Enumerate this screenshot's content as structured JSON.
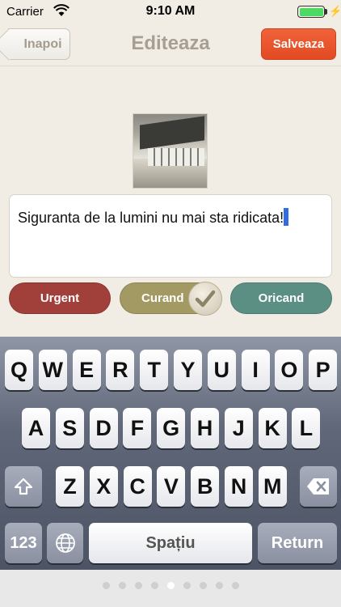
{
  "status_bar": {
    "carrier": "Carrier",
    "time": "9:10 AM",
    "battery_level": 1.0,
    "charging": true
  },
  "nav": {
    "back_label": "Inapoi",
    "title": "Editeaza",
    "save_label": "Salveaza"
  },
  "photo": {
    "icon": "photo-thumbnail"
  },
  "note": {
    "text": "Siguranta de la lumini nu mai sta ridicata",
    "trailing_char": "!"
  },
  "priority": {
    "options": [
      {
        "label": "Urgent",
        "color": "#a1403a",
        "selected": false
      },
      {
        "label": "Curand",
        "color": "#a39a63",
        "selected": true
      },
      {
        "label": "Oricand",
        "color": "#5b8f84",
        "selected": false
      }
    ]
  },
  "keyboard": {
    "row1": [
      "Q",
      "W",
      "E",
      "R",
      "T",
      "Y",
      "U",
      "I",
      "O",
      "P"
    ],
    "row2": [
      "A",
      "S",
      "D",
      "F",
      "G",
      "H",
      "J",
      "K",
      "L"
    ],
    "row3": [
      "Z",
      "X",
      "C",
      "V",
      "B",
      "N",
      "M"
    ],
    "numbers_label": "123",
    "space_label": "Spațiu",
    "return_label": "Return",
    "shift_icon": "shift-icon",
    "delete_icon": "delete-icon",
    "globe_icon": "globe-icon"
  },
  "pager": {
    "count": 9,
    "active_index": 4
  }
}
